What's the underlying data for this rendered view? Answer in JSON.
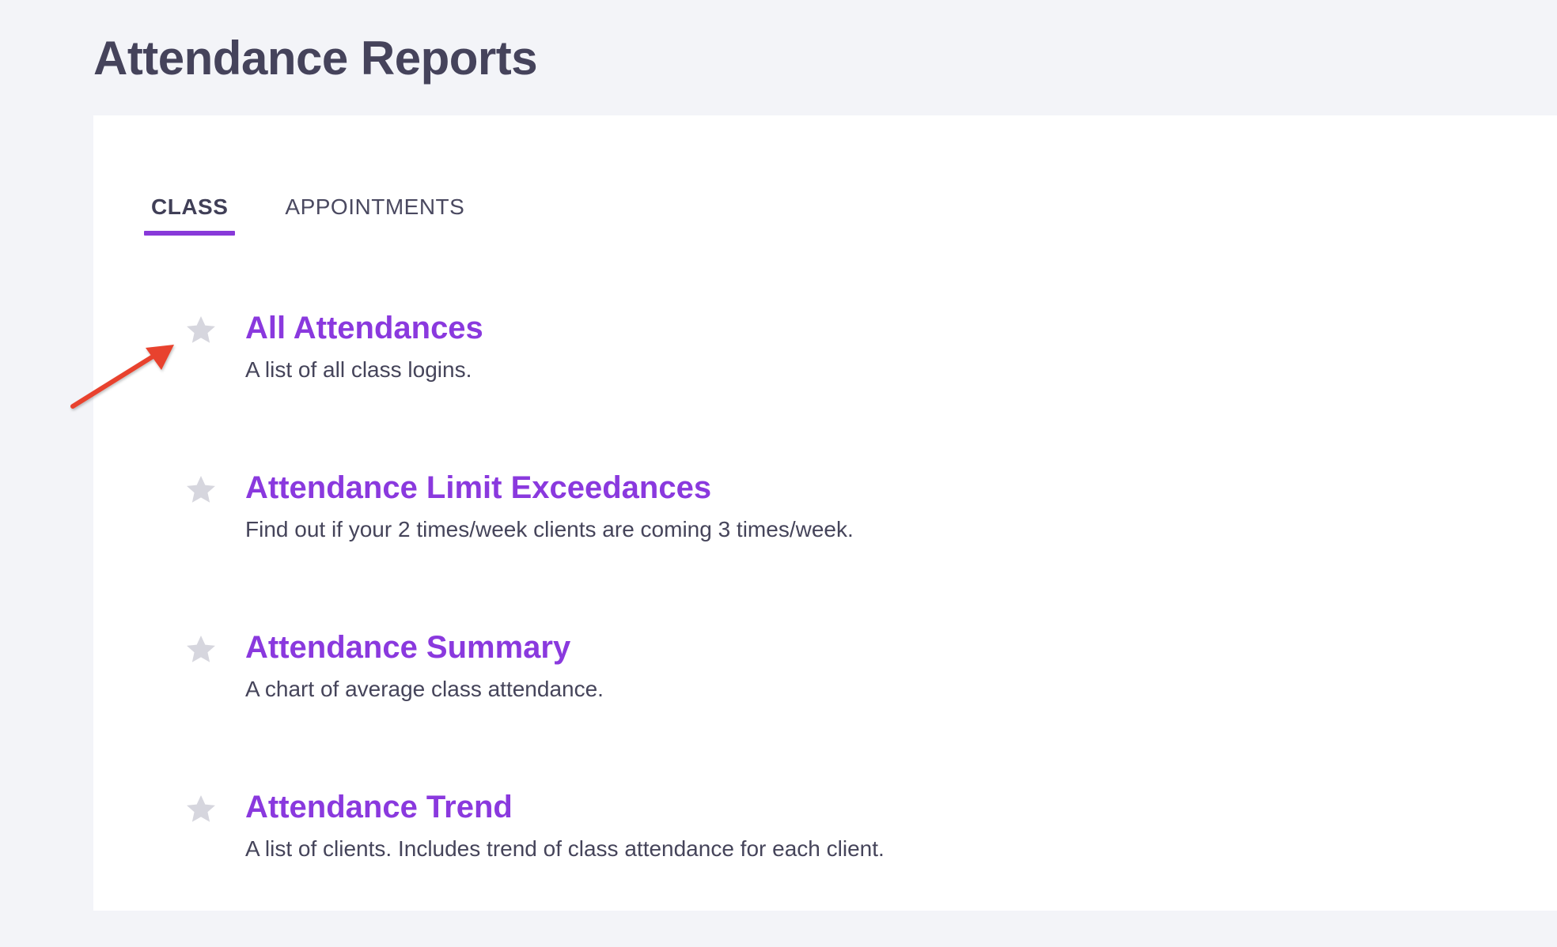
{
  "page": {
    "title": "Attendance Reports"
  },
  "tabs": [
    {
      "label": "CLASS",
      "active": true
    },
    {
      "label": "APPOINTMENTS",
      "active": false
    }
  ],
  "reports": [
    {
      "title": "All Attendances",
      "description": "A list of all class logins.",
      "favorite_icon": "star-icon"
    },
    {
      "title": "Attendance Limit Exceedances",
      "description": "Find out if your 2 times/week clients are coming 3 times/week.",
      "favorite_icon": "star-icon"
    },
    {
      "title": "Attendance Summary",
      "description": "A chart of average class attendance.",
      "favorite_icon": "star-icon"
    },
    {
      "title": "Attendance Trend",
      "description": "A list of clients. Includes trend of class attendance for each client.",
      "favorite_icon": "star-icon"
    }
  ],
  "annotation": {
    "icon": "red-arrow-icon",
    "color": "#e8432e"
  },
  "colors": {
    "accent": "#8a39de",
    "star": "#d6d6de",
    "background": "#f3f4f8",
    "panel": "#ffffff",
    "text": "#403f57"
  }
}
